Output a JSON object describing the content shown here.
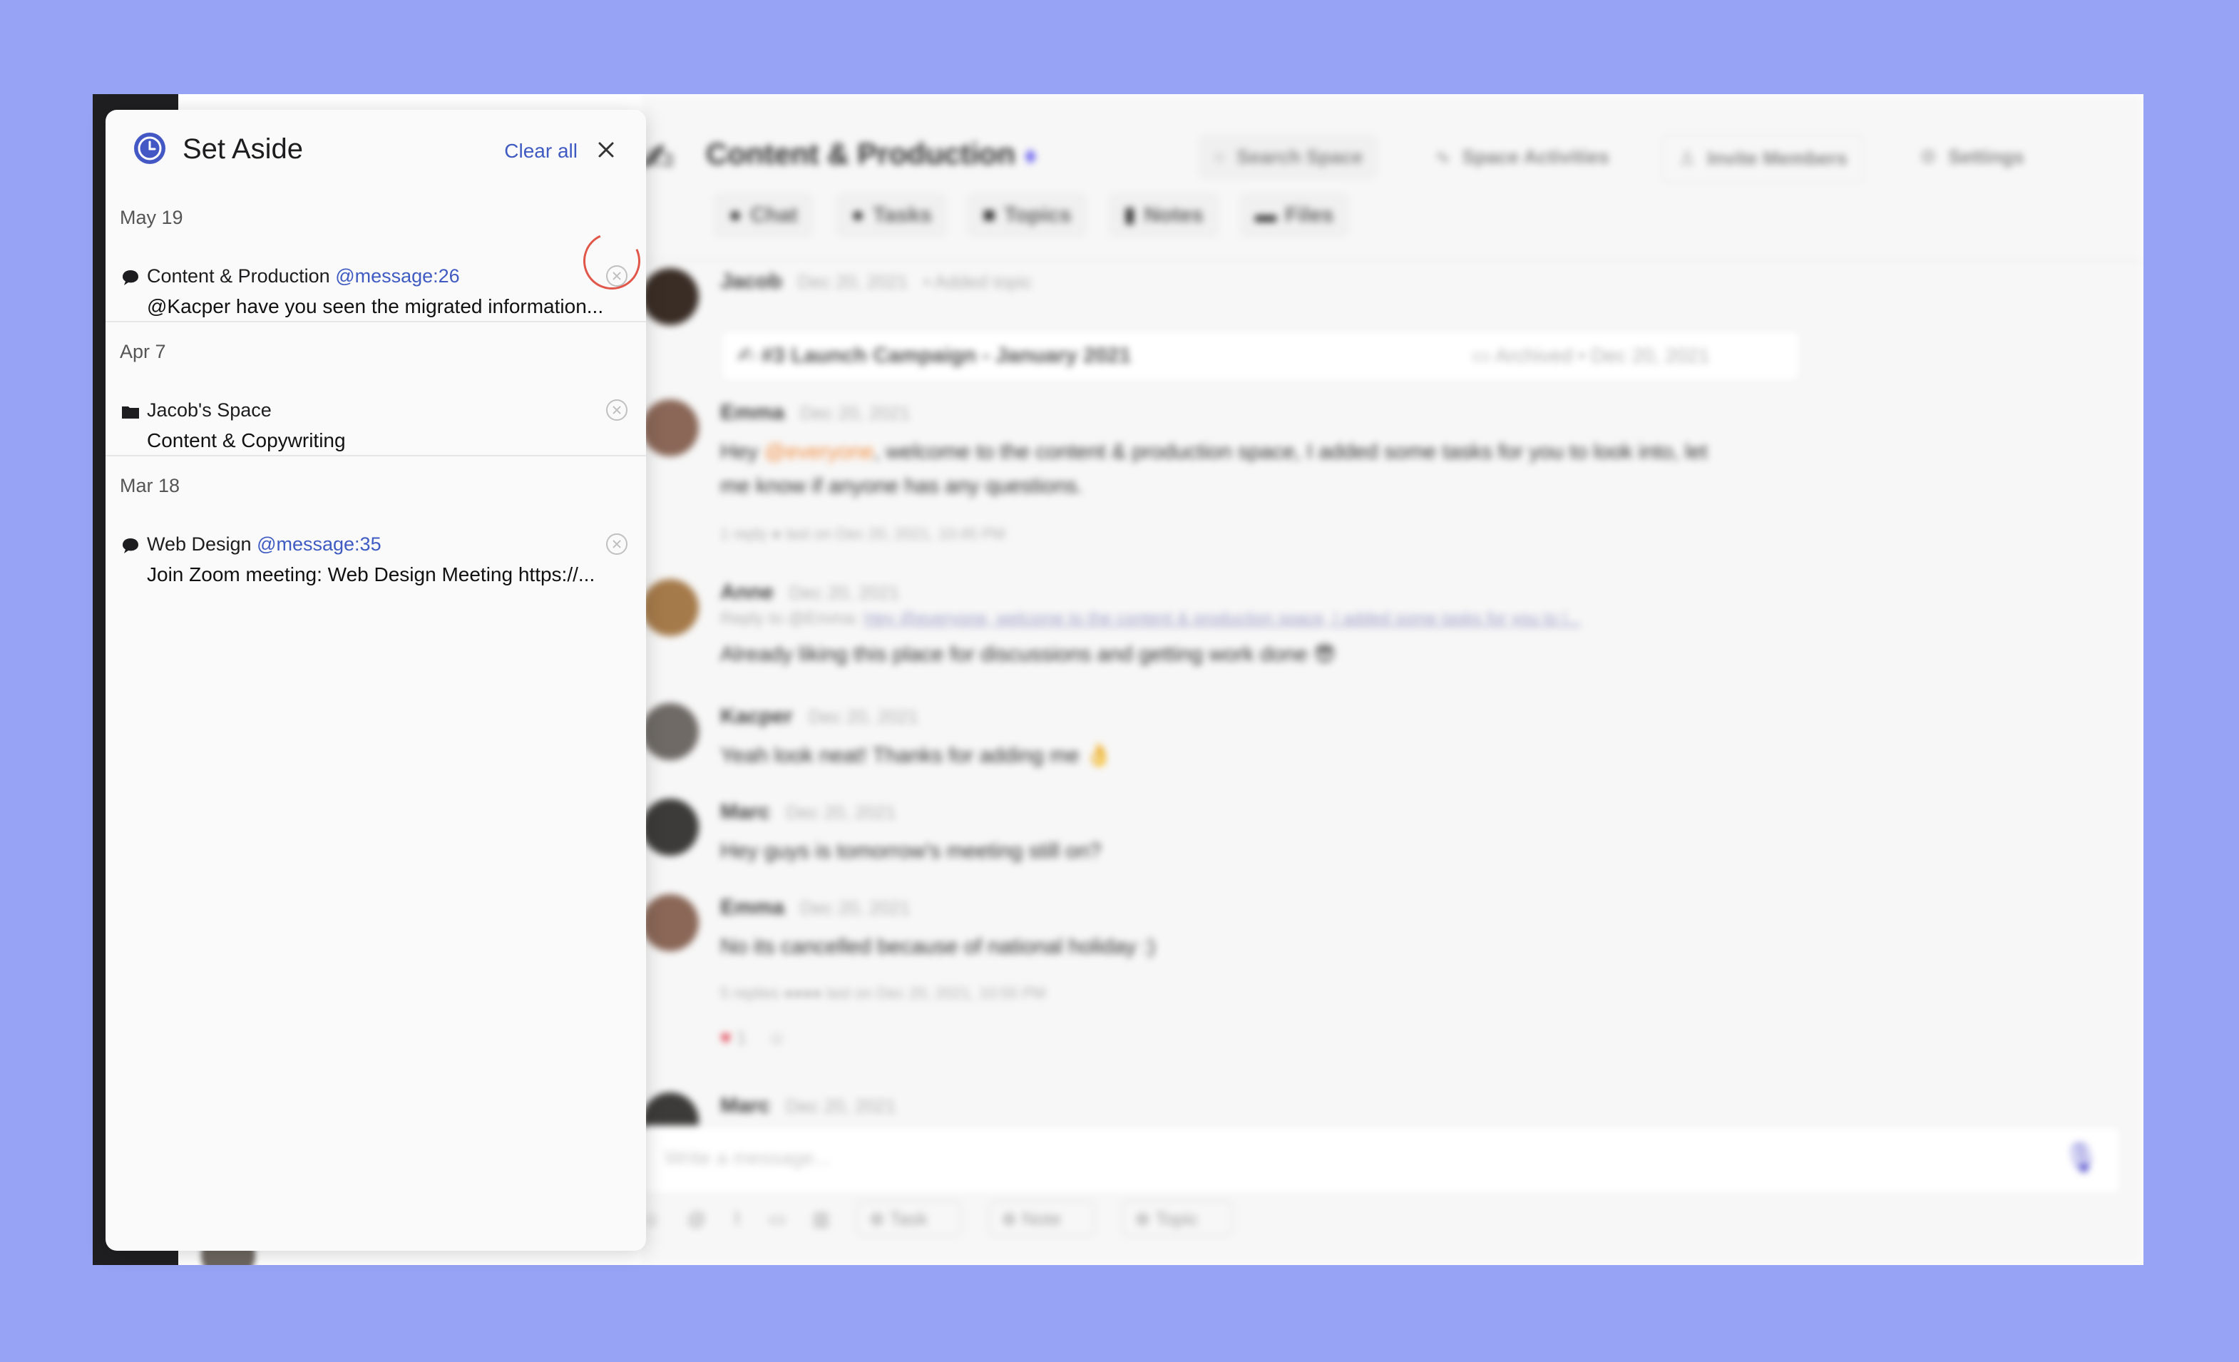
{
  "panel": {
    "title": "Set Aside",
    "clear_all_label": "Clear all",
    "groups": [
      {
        "date": "May 19",
        "items": [
          {
            "icon": "chat-bubble-icon",
            "source": "Content & Production",
            "ref": "@message:26",
            "preview": "@Kacper have you seen the migrated information..."
          }
        ]
      },
      {
        "date": "Apr 7",
        "items": [
          {
            "icon": "folder-icon",
            "source": "Jacob's Space",
            "ref": "",
            "preview": "Content & Copywriting"
          }
        ]
      },
      {
        "date": "Mar 18",
        "items": [
          {
            "icon": "chat-bubble-icon",
            "source": "Web Design",
            "ref": "@message:35",
            "preview": "Join Zoom meeting: Web Design Meeting https://..."
          }
        ]
      }
    ],
    "accent_color": "#3f5bc2",
    "highlight_color": "#e0574a"
  },
  "space": {
    "title": "Content & Production",
    "header_buttons": {
      "search": "Search Space",
      "activities": "Space Activities",
      "invite": "Invite Members",
      "settings": "Settings",
      "members_count": "5"
    },
    "tabs": [
      "Chat",
      "Tasks",
      "Topics",
      "Notes",
      "Files"
    ]
  },
  "messages": [
    {
      "author": "Jacob",
      "date": "Dec 20, 2021",
      "meta": "Added topic"
    },
    {
      "author": "Emma",
      "date": "Dec 20, 2021",
      "body_pre": "Hey ",
      "mention": "@everyone",
      "body_post": ", welcome to the content & production space, I added some tasks for you to look into, let me know if anyone has any questions.",
      "replies": "1 reply",
      "replies_meta": "last on Dec 20, 2021, 10:45 PM"
    },
    {
      "author": "Anne",
      "date": "Dec 20, 2021",
      "reply_label": "Reply to @Emma:",
      "reply_quote": "Hey @everyone, welcome to the content & production space, I added some tasks for you to l...",
      "body": "Already liking this place for discussions and getting work done 😎"
    },
    {
      "author": "Kacper",
      "date": "Dec 20, 2021",
      "body": "Yeah look neat! Thanks for adding me 👌"
    },
    {
      "author": "Marc",
      "date": "Dec 20, 2021",
      "body": "Hey guys is tomorrow's meeting still on?"
    },
    {
      "author": "Emma",
      "date": "Dec 20, 2021",
      "body": "No its cancelled because of national holiday :)",
      "replies": "5 replies",
      "replies_meta": "last on Dec 20, 2021, 10:55 PM",
      "reaction_count": "1"
    },
    {
      "author": "Marc",
      "date": "Dec 20, 2021"
    }
  ],
  "topic_card": {
    "title": "#3 Launch Campaign - January 2021",
    "status": "Archived",
    "date": "Dec 20, 2021"
  },
  "composer": {
    "placeholder": "Write a message...",
    "tools": [
      "Task",
      "Note",
      "Topic"
    ]
  }
}
